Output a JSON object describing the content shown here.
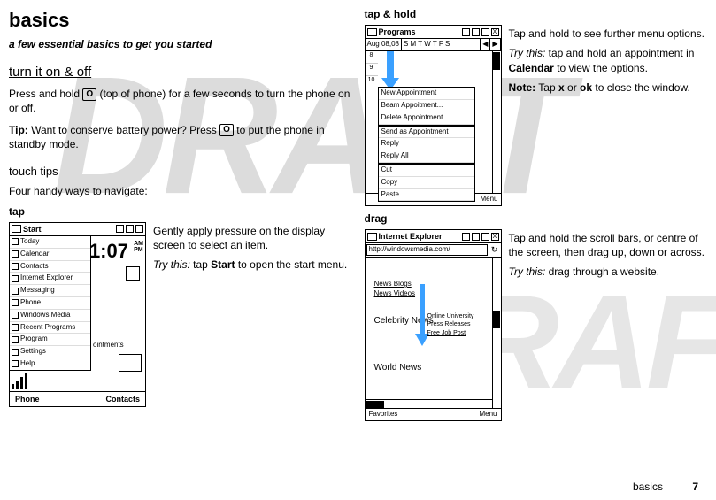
{
  "title": "basics",
  "subtitle": "a few essential basics to get you started",
  "section_turn": {
    "heading": "turn it on & off",
    "p1a": "Press and hold ",
    "key1": "O",
    "p1b": " (top of phone) for a few seconds to turn the phone on or off.",
    "tip_label": "Tip:",
    "tip_a": " Want to conserve battery power? Press ",
    "key2": "O",
    "tip_b": " to put the phone in standby mode."
  },
  "section_touch": {
    "heading": "touch tips",
    "intro": "Four handy ways to navigate:"
  },
  "tap": {
    "heading": "tap",
    "body": "Gently apply pressure on the display screen to select an item.",
    "try_label": "Try this:",
    "try_a": " tap ",
    "try_b": "Start",
    "try_c": " to open the start menu."
  },
  "taphold": {
    "heading": "tap & hold",
    "body": "Tap and hold to see further menu options.",
    "try_label": "Try this:",
    "try_a": " tap and hold an appointment in ",
    "try_b": "Calendar",
    "try_c": " to view the options.",
    "note_label": "Note:",
    "note_a": " Tap ",
    "note_x": "x",
    "note_b": " or ",
    "note_ok": "ok",
    "note_c": " to close the window."
  },
  "drag": {
    "heading": "drag",
    "body": "Tap and hold the scroll bars, or centre of the screen, then drag up, down or across.",
    "try_label": "Try this:",
    "try_a": " drag through a website."
  },
  "mock_start": {
    "title": "Start",
    "items": [
      "Today",
      "Calendar",
      "Contacts",
      "Internet Explorer",
      "Messaging",
      "Phone",
      "Windows Media",
      "Recent Programs",
      "Program",
      "Settings",
      "Help"
    ],
    "appt": "ointments",
    "clock": "1:07",
    "am": "AM",
    "pm": "PM",
    "left": "Phone",
    "right": "Contacts"
  },
  "mock_cal": {
    "title": "Programs",
    "date": "Aug 08,08",
    "days": "S M T W T F S",
    "hours": [
      "8",
      "9",
      "10"
    ],
    "ctx": [
      "New Appointment",
      "Beam Appoitment...",
      "Delete Appointment"
    ],
    "ctx2": [
      "Send as Appointment",
      "Reply",
      "Reply All"
    ],
    "ctx3": [
      "Cut",
      "Copy",
      "Paste"
    ],
    "menu": "Menu"
  },
  "mock_ie": {
    "title": "Internet Explorer",
    "url": "http://windowsmedia.com/",
    "left": [
      "News Blogs",
      "News Videos",
      "",
      "Celebrity News",
      "",
      "",
      "",
      "World News"
    ],
    "right": [
      "Online University",
      "Press Releases",
      "Free Job Post"
    ],
    "fav": "Favorites",
    "menu": "Menu"
  },
  "footer": {
    "label": "basics",
    "page": "7"
  }
}
